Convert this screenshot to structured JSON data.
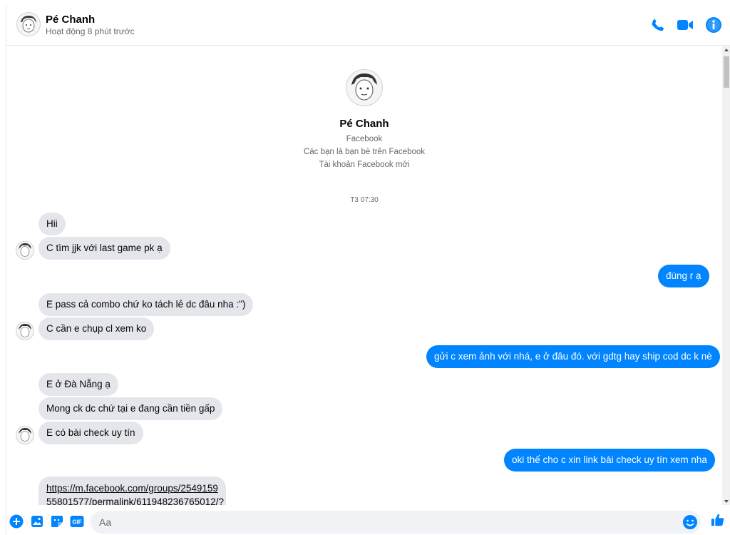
{
  "header": {
    "name": "Pé Chanh",
    "status": "Hoạt động 8 phút trước",
    "icons": [
      "phone-icon",
      "video-camera-icon",
      "info-icon"
    ]
  },
  "profile": {
    "name": "Pé Chanh",
    "lines": [
      "Facebook",
      "Các bạn là bạn bè trên Facebook",
      "Tài khoản Facebook mới"
    ]
  },
  "timestamp": "T3 07:30",
  "messages": [
    {
      "dir": "in",
      "text": "Hii"
    },
    {
      "dir": "in",
      "text": "C tìm jjk với last game pk ạ"
    },
    {
      "dir": "out",
      "text": "đúng r ạ"
    },
    {
      "dir": "in",
      "text": "E pass cả combo chứ ko tách lẻ dc đâu nha :\")"
    },
    {
      "dir": "in",
      "text": "C cần e chụp cl xem ko"
    },
    {
      "dir": "out",
      "text": "gửi c xem ảnh với nhá, e ở đâu đó. với gdtg hay ship cod dc k nè"
    },
    {
      "dir": "in",
      "text": "E ở Đà Nẵng ạ"
    },
    {
      "dir": "in",
      "text": "Mong ck dc chứ tại e đang cần tiền gấp"
    },
    {
      "dir": "in",
      "text": "E có bài check uy tín"
    },
    {
      "dir": "out",
      "text": "oki thế cho c xin link bài check uy tín xem nha"
    },
    {
      "dir": "in",
      "link_line1": "https://m.facebook.com/groups/2549159",
      "link_line2": "55801577/permalink/611948236765012/?"
    }
  ],
  "composer": {
    "placeholder": "Aa",
    "icons": [
      "plus-icon",
      "image-icon",
      "sticker-icon",
      "gif-icon",
      "emoji-icon",
      "thumbs-up-icon"
    ],
    "gif_label": "GIF"
  },
  "colors": {
    "accent": "#0084ff",
    "incoming_bubble": "#e4e6eb",
    "secondary_text": "#65676b"
  }
}
